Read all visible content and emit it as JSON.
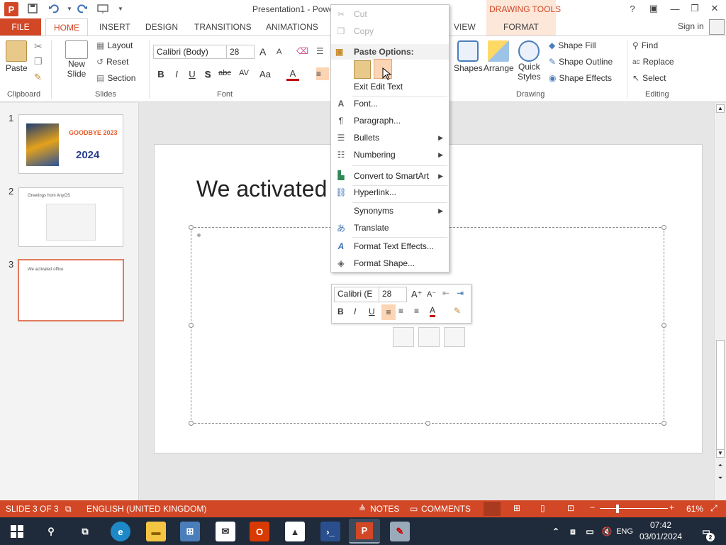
{
  "titlebar": {
    "app_letter": "P",
    "doc_title": "Presentation1 - Powe",
    "help": "?",
    "restore_ribbon": "▣",
    "minimize": "—",
    "maximize": "❐",
    "close": "✕"
  },
  "tabs": {
    "file": "FILE",
    "home": "HOME",
    "insert": "INSERT",
    "design": "DESIGN",
    "transitions": "TRANSITIONS",
    "animations": "ANIMATIONS",
    "view": "VIEW",
    "drawing_tools": "DRAWING TOOLS",
    "format": "FORMAT",
    "signin": "Sign in"
  },
  "ribbon": {
    "clipboard": {
      "paste": "Paste",
      "label": "Clipboard"
    },
    "slides": {
      "new_slide_1": "New",
      "new_slide_2": "Slide",
      "layout": "Layout",
      "reset": "Reset",
      "section": "Section",
      "label": "Slides"
    },
    "font": {
      "name": "Calibri (Body)",
      "size": "28",
      "bold": "B",
      "italic": "I",
      "underline": "U",
      "shadow": "S",
      "strike": "abc",
      "spacing": "AV",
      "case": "Aa",
      "color": "A",
      "grow": "A",
      "shrink": "A",
      "label": "Font"
    },
    "drawing": {
      "shapes": "Shapes",
      "arrange": "Arrange",
      "quick_1": "Quick",
      "quick_2": "Styles",
      "fill": "Shape Fill",
      "outline": "Shape Outline",
      "effects": "Shape Effects",
      "label": "Drawing"
    },
    "editing": {
      "find": "Find",
      "replace": "Replace",
      "select": "Select",
      "label": "Editing"
    }
  },
  "thumbnails": [
    {
      "num": "1",
      "text_top": "GOODBYE 2023",
      "text_bottom": "2024"
    },
    {
      "num": "2",
      "text": "Greetings from AnyOS"
    },
    {
      "num": "3",
      "text": "We activated office"
    }
  ],
  "slide": {
    "title": "We activated"
  },
  "context_menu": {
    "cut": "Cut",
    "copy": "Copy",
    "paste_options": "Paste Options:",
    "exit_edit": "Exit Edit Text",
    "font": "Font...",
    "paragraph": "Paragraph...",
    "bullets": "Bullets",
    "numbering": "Numbering",
    "smartart": "Convert to SmartArt",
    "hyperlink": "Hyperlink...",
    "synonyms": "Synonyms",
    "translate": "Translate",
    "text_effects": "Format Text Effects...",
    "format_shape": "Format Shape..."
  },
  "mini_toolbar": {
    "font": "Calibri (E",
    "size": "28",
    "bold": "B",
    "italic": "I",
    "underline": "U",
    "color": "A"
  },
  "statusbar": {
    "slide_of": "SLIDE 3 OF 3",
    "language": "ENGLISH (UNITED KINGDOM)",
    "notes": "NOTES",
    "comments": "COMMENTS",
    "zoom": "61%"
  },
  "taskbar": {
    "time": "07:42",
    "date": "03/01/2024",
    "lang": "ENG",
    "notif_count": "2"
  },
  "colors": {
    "accent": "#d24726",
    "taskbar": "#1f2b3a"
  }
}
